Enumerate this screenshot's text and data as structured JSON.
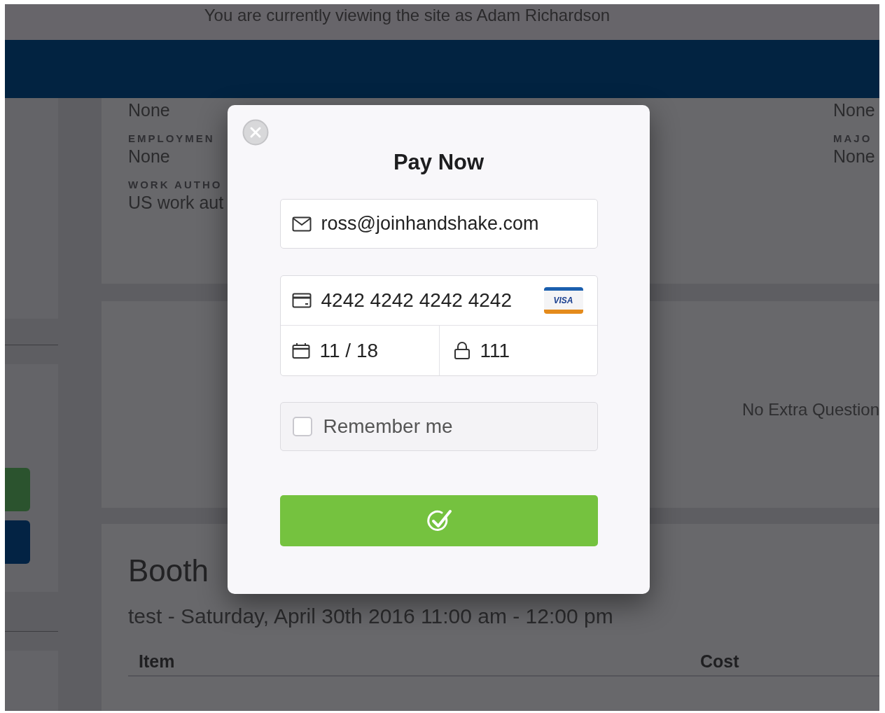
{
  "banner": {
    "text": "You are currently viewing the site as Adam Richardson"
  },
  "profile_card": {
    "left": [
      {
        "kind": "value",
        "text": "None"
      },
      {
        "kind": "label",
        "text": "EMPLOYMEN"
      },
      {
        "kind": "value",
        "text": "None"
      },
      {
        "kind": "label",
        "text": "WORK AUTHO"
      },
      {
        "kind": "value",
        "text": "US work aut"
      }
    ],
    "right": [
      {
        "kind": "value",
        "text": "None"
      },
      {
        "kind": "label",
        "text": "MAJO"
      },
      {
        "kind": "value",
        "text": "None"
      }
    ]
  },
  "questions_card": {
    "text": "No Extra Question"
  },
  "booth_card": {
    "title": "Booth",
    "subtitle": "test - Saturday, April 30th 2016 11:00 am - 12:00 pm",
    "columns": [
      "Item",
      "Cost"
    ]
  },
  "modal": {
    "title": "Pay Now",
    "email": "ross@joinhandshake.com",
    "card_number": "4242 4242 4242 4242",
    "card_brand": "VISA",
    "expiry": "11 / 18",
    "cvc": "111",
    "remember": {
      "label": "Remember me",
      "checked": false
    }
  }
}
